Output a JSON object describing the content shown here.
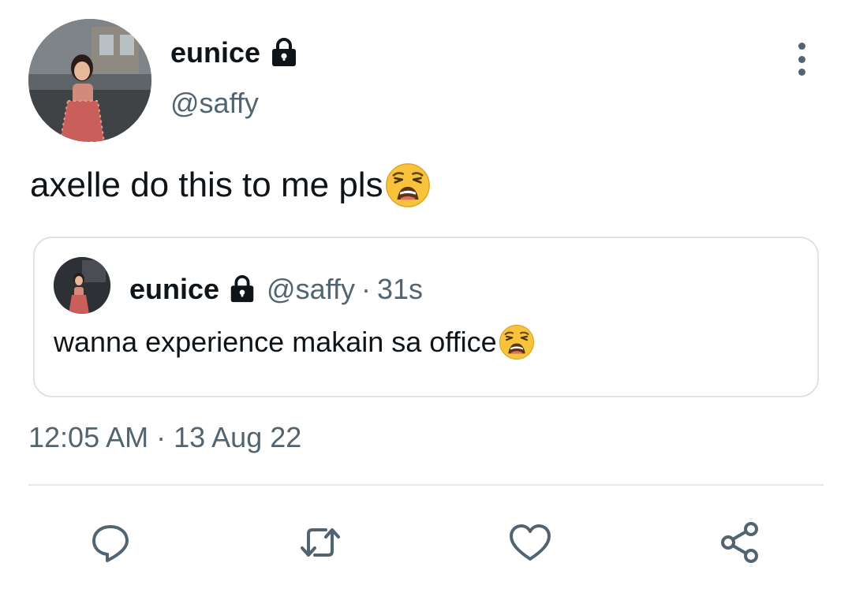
{
  "tweet": {
    "author": {
      "display_name": "eunice",
      "handle": "@saffy",
      "protected": true
    },
    "text": "axelle do this to me pls",
    "emoji": "weary-face",
    "timestamp": {
      "time": "12:05 AM",
      "separator": "·",
      "date": "13 Aug 22"
    }
  },
  "quoted_tweet": {
    "display_name": "eunice",
    "handle": "@saffy",
    "separator": "·",
    "age": "31s",
    "text": "wanna experience makain sa office",
    "emoji": "weary-face"
  },
  "actions": [
    "reply-icon",
    "retweet-icon",
    "like-icon",
    "share-icon"
  ],
  "colors": {
    "text_primary": "#0f1419",
    "text_secondary": "#536471",
    "border": "#dfe3e6",
    "emoji_yellow": "#f7c33c"
  }
}
